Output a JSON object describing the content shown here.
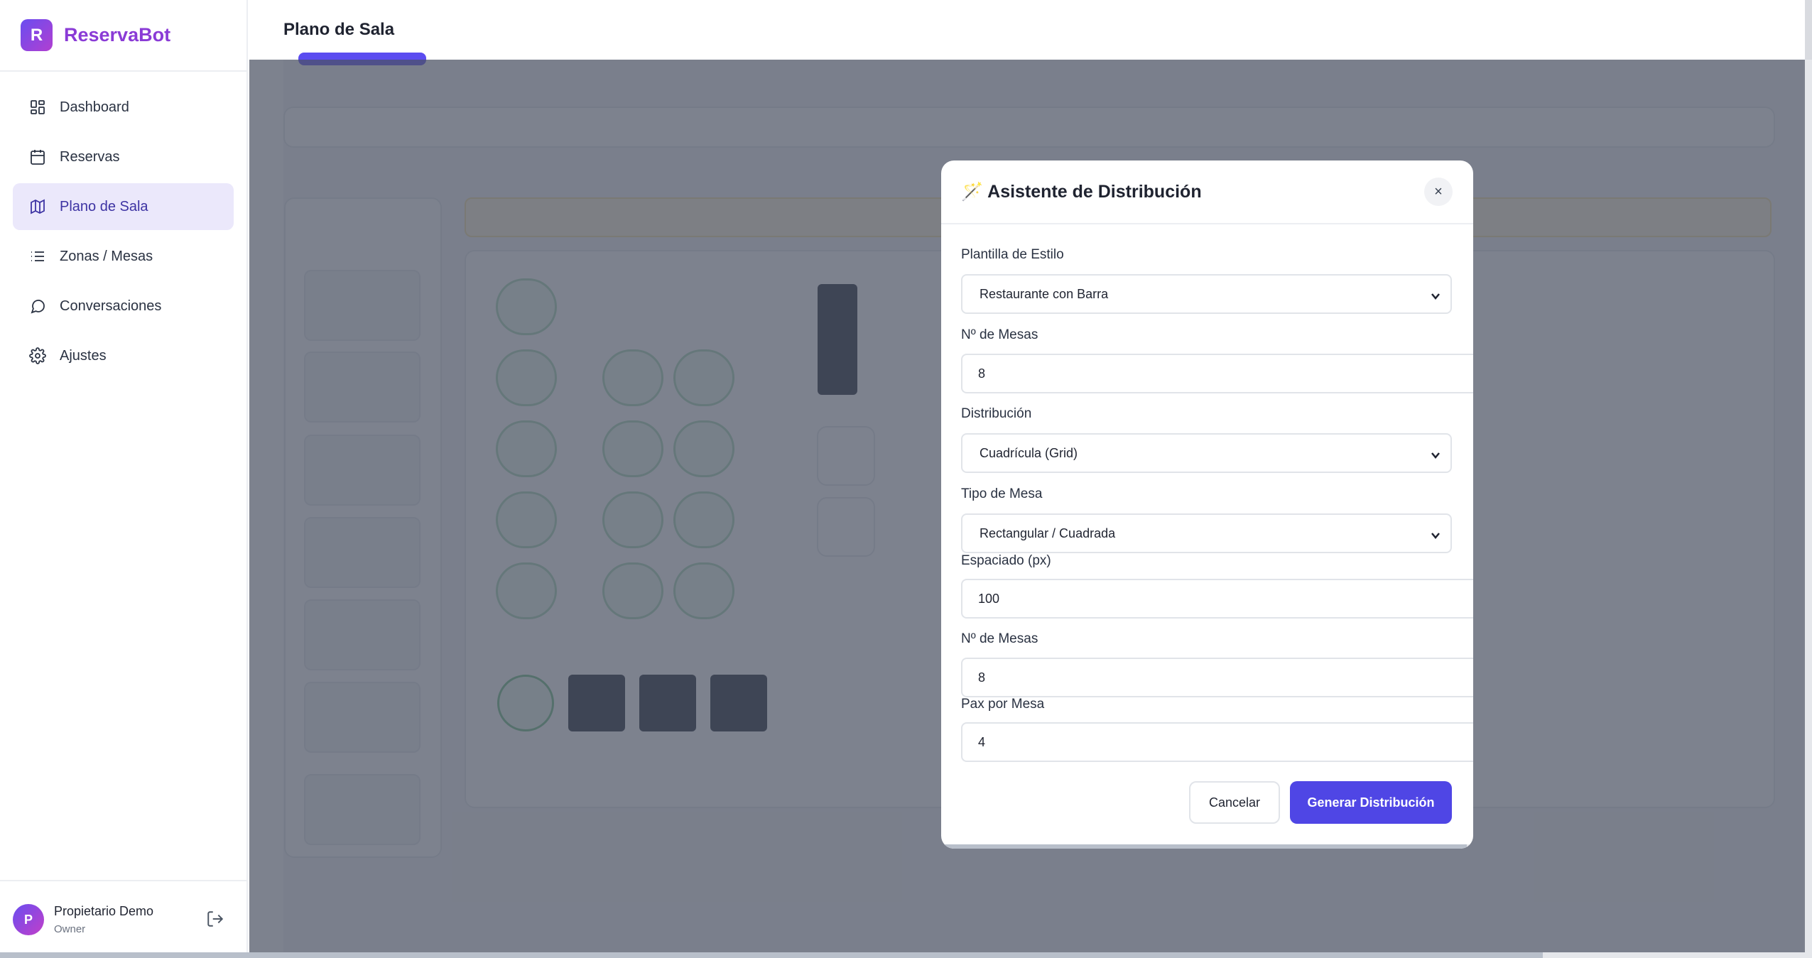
{
  "brand": {
    "logo_letter": "R",
    "name": "ReservaBot"
  },
  "sidebar": {
    "items": [
      {
        "label": "Dashboard",
        "icon": "layout-grid-icon",
        "active": false
      },
      {
        "label": "Reservas",
        "icon": "calendar-icon",
        "active": false
      },
      {
        "label": "Plano de Sala",
        "icon": "map-icon",
        "active": true
      },
      {
        "label": "Zonas / Mesas",
        "icon": "list-icon",
        "active": false
      },
      {
        "label": "Conversaciones",
        "icon": "chat-bubble-icon",
        "active": false
      },
      {
        "label": "Ajustes",
        "icon": "gear-icon",
        "active": false
      }
    ]
  },
  "user": {
    "initial": "P",
    "name": "Propietario Demo",
    "role": "Owner",
    "logout_icon": "logout-icon"
  },
  "header": {
    "title": "Plano de Sala"
  },
  "modal": {
    "title": "🪄 Asistente de Distribución",
    "close_label": "×",
    "fields": {
      "template": {
        "label": "Plantilla de Estilo",
        "value": "Restaurante con Barra"
      },
      "num_tables_1": {
        "label": "Nº de Mesas",
        "value": "8"
      },
      "distribution": {
        "label": "Distribución",
        "value": "Cuadrícula (Grid)"
      },
      "table_type": {
        "label": "Tipo de Mesa",
        "value": "Rectangular / Cuadrada"
      },
      "spacing": {
        "label": "Espaciado (px)",
        "value": "100"
      },
      "num_tables_2": {
        "label": "Nº de Mesas",
        "value": "8"
      },
      "pax": {
        "label": "Pax por Mesa",
        "value": "4"
      }
    },
    "cancel_label": "Cancelar",
    "submit_label": "Generar Distribución"
  },
  "colors": {
    "primary": "#4f46e5",
    "brand": "#8a3bd6",
    "active_nav_bg": "#ebe8fb",
    "overlay": "#4b5262"
  }
}
